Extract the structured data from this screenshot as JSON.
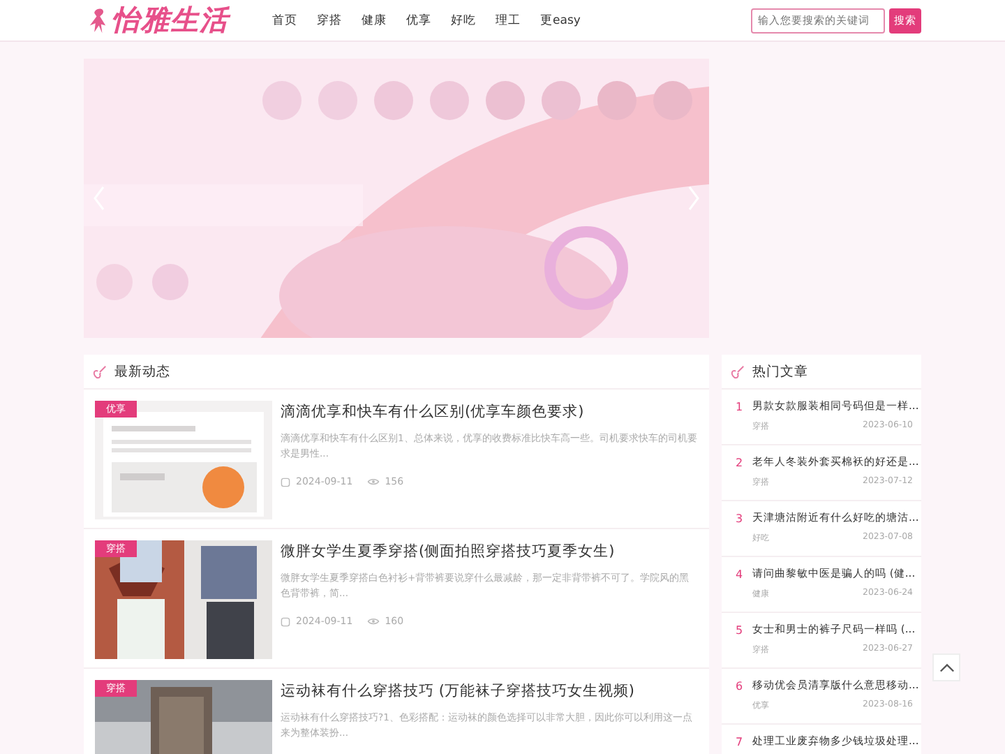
{
  "header": {
    "logo": "怡雅生活",
    "nav": [
      {
        "label": "首页",
        "selected": false
      },
      {
        "label": "穿搭",
        "selected": false
      },
      {
        "label": "健康",
        "selected": false
      },
      {
        "label": "优享",
        "selected": false
      },
      {
        "label": "好吃",
        "selected": false
      },
      {
        "label": "理工",
        "selected": false
      },
      {
        "label": "更easy",
        "selected": false
      }
    ],
    "search": {
      "placeholder": "输入您要搜索的关键词",
      "button": "搜索"
    }
  },
  "latest": {
    "title": "最新动态",
    "items": [
      {
        "tag": "优享",
        "title": "滴滴优享和快车有什么区别(优享车颜色要求)",
        "summary": "滴滴优享和快车有什么区别1、总体来说，优享的收费标准比快车高一些。司机要求快车的司机要求是男性...",
        "date": "2024-09-11",
        "views": "156"
      },
      {
        "tag": "穿搭",
        "title": "微胖女学生夏季穿搭(侧面拍照穿搭技巧夏季女生)",
        "summary": "微胖女学生夏季穿搭白色衬衫+背带裤要说穿什么最减龄，那一定非背带裤不可了。学院风的黑色背带裤，简...",
        "date": "2024-09-11",
        "views": "160"
      },
      {
        "tag": "穿搭",
        "title": "运动袜有什么穿搭技巧 (万能袜子穿搭技巧女生视频)",
        "summary": "运动袜有什么穿搭技巧?1、色彩搭配：运动袜的颜色选择可以非常大胆，因此你可以利用这一点来为整体装扮..."
      }
    ]
  },
  "hot": {
    "title": "热门文章",
    "items": [
      {
        "rank": "1",
        "title": "男款女款服装相同号码但是一样...",
        "category": "穿搭",
        "date": "2023-06-10"
      },
      {
        "rank": "2",
        "title": "老年人冬装外套买棉袄的好还是...",
        "category": "穿搭",
        "date": "2023-07-12"
      },
      {
        "rank": "3",
        "title": "天津塘沽附近有什么好吃的塘沽...",
        "category": "好吃",
        "date": "2023-07-08"
      },
      {
        "rank": "4",
        "title": "请问曲黎敏中医是骗人的吗 (健...",
        "category": "健康",
        "date": "2023-06-24"
      },
      {
        "rank": "5",
        "title": "女士和男士的裤子尺码一样吗 (...",
        "category": "穿搭",
        "date": "2023-06-27"
      },
      {
        "rank": "6",
        "title": "移动优会员清享版什么意思移动...",
        "category": "优享",
        "date": "2023-08-16"
      },
      {
        "rank": "7",
        "title": "处理工业废弃物多少钱垃圾处理..."
      }
    ]
  }
}
